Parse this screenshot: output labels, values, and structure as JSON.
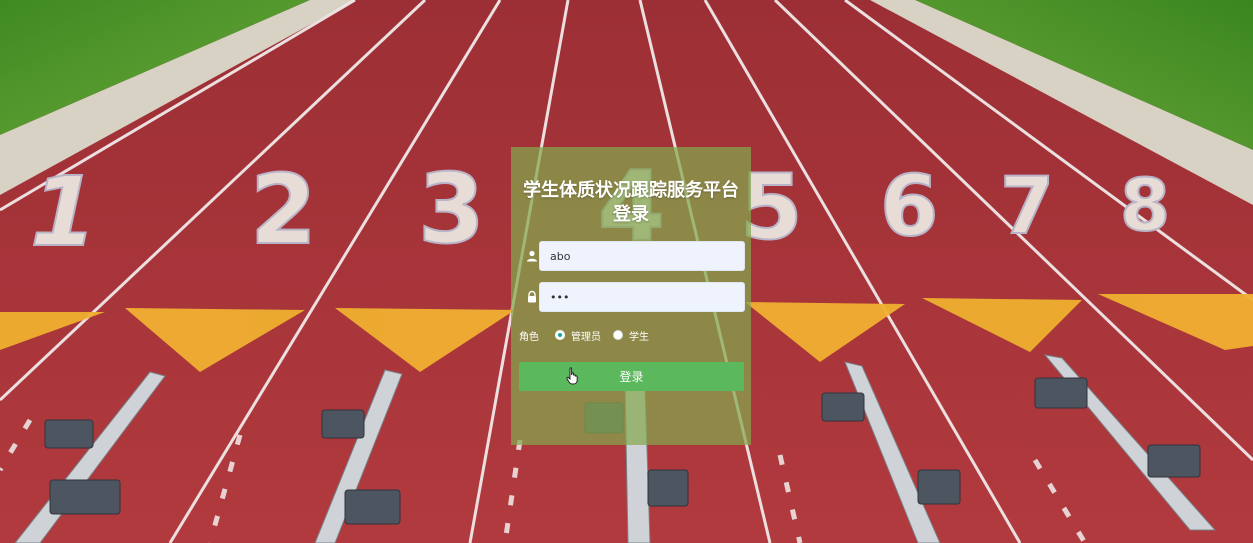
{
  "login": {
    "title": "学生体质状况跟踪服务平台登录",
    "username": {
      "value": "abo",
      "icon": "user-icon"
    },
    "password": {
      "value": "•••",
      "icon": "lock-icon"
    },
    "role": {
      "label": "角色",
      "options": [
        {
          "label": "管理员",
          "selected": true
        },
        {
          "label": "学生",
          "selected": false
        }
      ]
    },
    "submit_label": "登录"
  },
  "background": {
    "lane_numbers": [
      "1",
      "2",
      "3",
      "4",
      "5",
      "6",
      "7",
      "8"
    ],
    "colors": {
      "track": "#a8323a",
      "grass": "#4c8f2a",
      "chevron": "#f0b030",
      "panel": "#84a84e",
      "button": "#5cb85c",
      "radio_checked": "#13a89e"
    }
  },
  "cursor": {
    "icon": "hand-pointer-icon"
  }
}
